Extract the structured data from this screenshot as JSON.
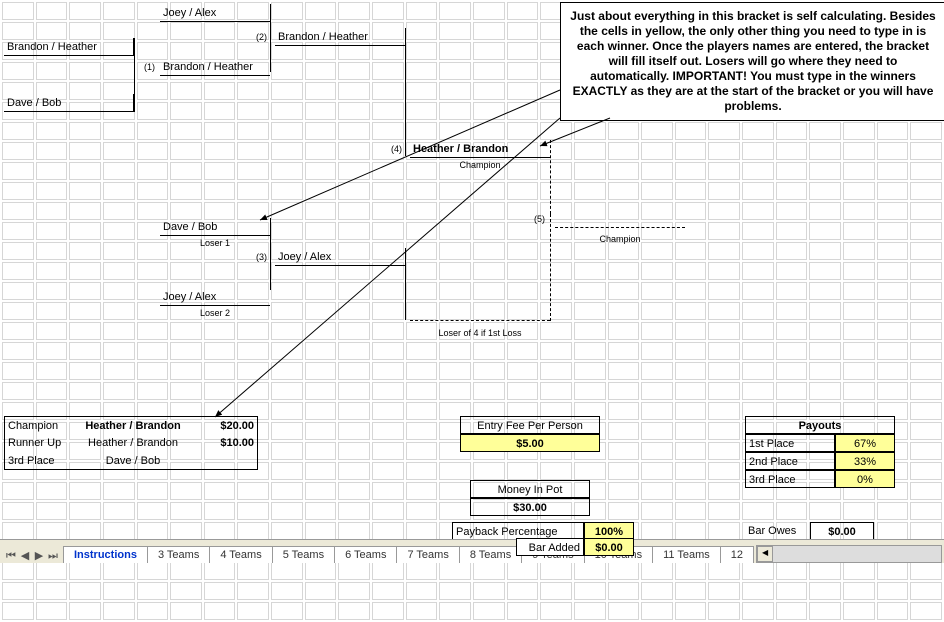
{
  "bracket": {
    "s1": "Brandon / Heather",
    "s2": "Dave / Bob",
    "w1_top": "Joey / Alex",
    "m1_num": "(1)",
    "w1_winner": "Brandon / Heather",
    "m2_num": "(2)",
    "w2_winner": "Brandon / Heather",
    "m4_num": "(4)",
    "w4_winner": "Heather / Brandon",
    "champion_lbl_small": "Champion",
    "m5_num": "(5)",
    "champion2": "Champion",
    "l1": "Dave / Bob",
    "l1_lbl": "Loser 1",
    "m3_num": "(3)",
    "l3_winner": "Joey / Alex",
    "l2": "Joey / Alex",
    "l2_lbl": "Loser 2",
    "l4_lbl": "Loser of 4 if 1st Loss"
  },
  "results": {
    "champ_lbl": "Champion",
    "champ_name": "Heather / Brandon",
    "champ_pay": "$20.00",
    "runner_lbl": "Runner Up",
    "runner_name": "Heather / Brandon",
    "runner_pay": "$10.00",
    "third_lbl": "3rd Place",
    "third_name": "Dave / Bob"
  },
  "money": {
    "entry_lbl": "Entry Fee Per Person",
    "entry_val": "$5.00",
    "pot_lbl": "Money In Pot",
    "pot_val": "$30.00",
    "payback_lbl": "Payback Percentage",
    "payback_val": "100%",
    "bar_lbl": "Bar Added",
    "bar_val": "$0.00",
    "owes_lbl": "Bar Owes",
    "owes_val": "$0.00"
  },
  "payouts": {
    "hdr": "Payouts",
    "p1_lbl": "1st Place",
    "p1_val": "67%",
    "p2_lbl": "2nd Place",
    "p2_val": "33%",
    "p3_lbl": "3rd Place",
    "p3_val": "0%"
  },
  "callout": "Just about everything in this bracket is self calculating. Besides the cells in yellow, the only other thing you need to type in is each winner. Once the players names are entered, the bracket will fill itself out. Losers will go where they need to automatically. IMPORTANT! You must type in the winners EXACTLY as they are at the start of the bracket or you will have problems.",
  "tabs": {
    "t0": "Instructions",
    "t1": "3 Teams",
    "t2": "4 Teams",
    "t3": "5 Teams",
    "t4": "6 Teams",
    "t5": "7 Teams",
    "t6": "8 Teams",
    "t7": "9 Teams",
    "t8": "10 Teams",
    "t9": "11 Teams",
    "t10": "12"
  }
}
